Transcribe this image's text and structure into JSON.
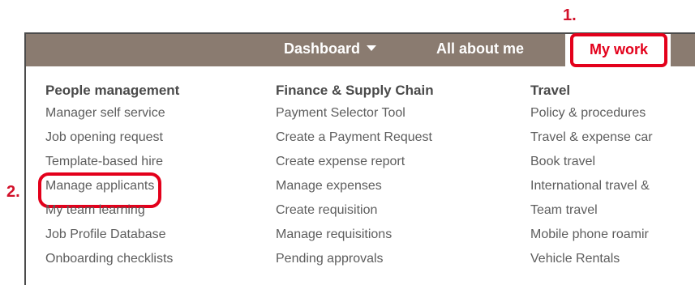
{
  "callouts": {
    "step1": "1.",
    "step2": "2."
  },
  "nav": {
    "dashboard": "Dashboard",
    "all_about_me": "All about me",
    "my_work": "My work"
  },
  "columns": [
    {
      "heading": "People management",
      "items": [
        "Manager self service",
        "Job opening request",
        "Template-based hire",
        "Manage applicants",
        "My team learning",
        "Job Profile Database",
        "Onboarding checklists"
      ]
    },
    {
      "heading": "Finance & Supply Chain",
      "items": [
        "Payment Selector Tool",
        "Create a Payment Request",
        "Create expense report",
        "Manage expenses",
        "Create requisition",
        "Manage requisitions",
        "Pending approvals"
      ]
    },
    {
      "heading": "Travel",
      "items": [
        "Policy & procedures",
        "Travel & expense car",
        "Book travel",
        "International travel &",
        "Team travel",
        "Mobile phone roamir",
        "Vehicle Rentals"
      ]
    }
  ],
  "colors": {
    "topbar": "#8a7b70",
    "highlight": "#e3001b",
    "callout": "#d2112a"
  }
}
